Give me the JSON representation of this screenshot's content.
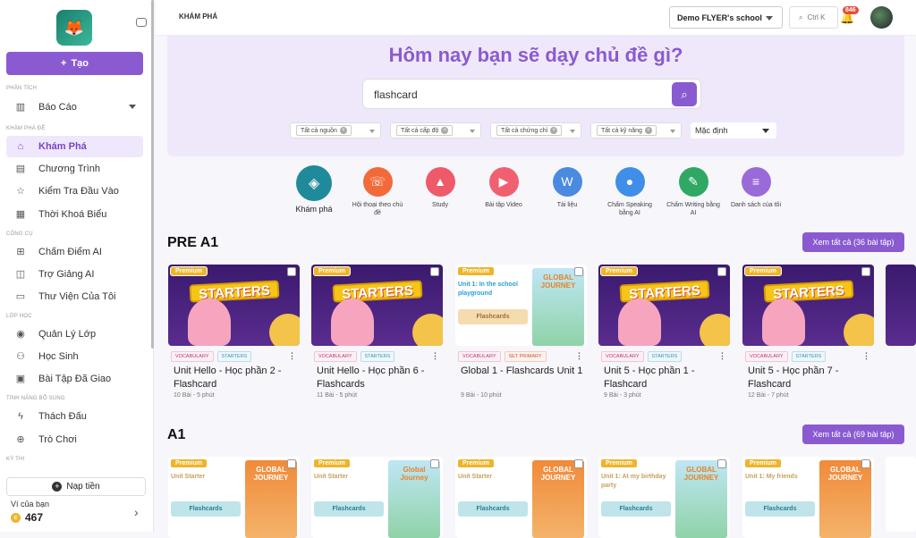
{
  "sidebar": {
    "create_label": "Tạo",
    "sections": {
      "analysis": "PHÂN TÍCH",
      "explore": "KHÁM PHÁ ĐỀ",
      "tools": "CÔNG CỤ",
      "classes": "LỚP HỌC",
      "extras": "TÍNH NĂNG BỔ SUNG",
      "exams": "KỲ THI"
    },
    "items": [
      {
        "label": "Báo Cáo",
        "icon": "report-icon"
      },
      {
        "label": "Khám Phá",
        "icon": "home-icon"
      },
      {
        "label": "Chương Trình",
        "icon": "document-icon"
      },
      {
        "label": "Kiểm Tra Đầu Vào",
        "icon": "star-icon"
      },
      {
        "label": "Thời Khoá Biểu",
        "icon": "calendar-icon"
      },
      {
        "label": "Chấm Điểm AI",
        "icon": "ai-grade-icon"
      },
      {
        "label": "Trợ Giảng AI",
        "icon": "ai-assistant-icon"
      },
      {
        "label": "Thư Viện Của Tôi",
        "icon": "folder-icon"
      },
      {
        "label": "Quản Lý Lớp",
        "icon": "class-icon"
      },
      {
        "label": "Học Sinh",
        "icon": "student-icon"
      },
      {
        "label": "Bài Tập Đã Giao",
        "icon": "assignment-icon"
      },
      {
        "label": "Thách Đấu",
        "icon": "lightning-icon"
      },
      {
        "label": "Trò Chơi",
        "icon": "gamepad-icon"
      }
    ],
    "wallet": {
      "topup_label": "Nạp tiền",
      "label": "Ví của bạn",
      "value": "467"
    }
  },
  "topbar": {
    "breadcrumb": "KHÁM PHÁ",
    "school": "Demo FLYER's school",
    "search_shortcut": "Ctrl K",
    "notif_count": "846"
  },
  "hero": {
    "title": "Hôm nay bạn sẽ dạy chủ đề gì?",
    "search_value": "flashcard",
    "filters": [
      "Tất cả nguồn",
      "Tất cả cấp độ",
      "Tất cả chứng chỉ",
      "Tất cả kỹ năng"
    ],
    "sort": "Mặc định"
  },
  "quick_actions": [
    {
      "label": "Khám phá",
      "color": "#1f8a9a",
      "icon": "compass-icon"
    },
    {
      "label": "Hội thoại theo chủ đề",
      "color": "#f26a3a",
      "icon": "phone-icon"
    },
    {
      "label": "Study",
      "color": "#ee5a6a",
      "icon": "graduation-icon"
    },
    {
      "label": "Bài tập Video",
      "color": "#f06070",
      "icon": "video-icon"
    },
    {
      "label": "Tài liệu",
      "color": "#4a8ae0",
      "icon": "word-icon"
    },
    {
      "label": "Chấm Speaking bằng AI",
      "color": "#3f8ee8",
      "icon": "microphone-icon"
    },
    {
      "label": "Chấm Writing bằng AI",
      "color": "#2fa866",
      "icon": "pen-icon"
    },
    {
      "label": "Danh sách của tôi",
      "color": "#9a6ad8",
      "icon": "list-icon"
    }
  ],
  "sections": [
    {
      "title": "PRE A1",
      "see_all": "Xem tất cả (36 bài tập)",
      "cards": [
        {
          "type": "starters",
          "premium": "Premium",
          "banner": "STARTERS",
          "tags": [
            "VOCABULARY",
            "STARTERS"
          ],
          "title": "Unit Hello - Học phần 2 - Flashcard",
          "meta": "10 Bài - 5 phút"
        },
        {
          "type": "starters",
          "premium": "Premium",
          "banner": "STARTERS",
          "tags": [
            "VOCABULARY",
            "STARTERS"
          ],
          "title": "Unit Hello - Học phần 6 - Flashcards",
          "meta": "11 Bài - 5 phút"
        },
        {
          "type": "global",
          "premium": "Premium",
          "lesson": "Unit 1: In the school playground",
          "flash": "Flashcards",
          "book": "GLOBAL JOURNEY",
          "tags": [
            "VOCABULARY",
            "SET PRIMARY"
          ],
          "title": "Global 1 - Flashcards Unit 1",
          "meta": "9 Bài - 10 phút"
        },
        {
          "type": "starters",
          "premium": "Premium",
          "banner": "STARTERS",
          "tags": [
            "VOCABULARY",
            "STARTERS"
          ],
          "title": "Unit 5 - Học phần 1 - Flashcard",
          "meta": "9 Bài - 3 phút"
        },
        {
          "type": "starters",
          "premium": "Premium",
          "banner": "STARTERS",
          "tags": [
            "VOCABULARY",
            "STARTERS"
          ],
          "title": "Unit 5 - Học phần 7 - Flashcard",
          "meta": "12 Bài - 7 phút"
        }
      ]
    },
    {
      "title": "A1",
      "see_all": "Xem tất cả (69 bài tập)",
      "cards": [
        {
          "premium": "Premium",
          "lesson": "Unit Starter",
          "flash": "Flashcards",
          "book": "GLOBAL JOURNEY"
        },
        {
          "premium": "Premium",
          "lesson": "Unit Starter",
          "flash": "Flashcards",
          "book": "Global Journey"
        },
        {
          "premium": "Premium",
          "lesson": "Unit Starter",
          "flash": "Flashcards",
          "book": "GLOBAL JOURNEY"
        },
        {
          "premium": "Premium",
          "lesson": "Unit 1: At my birthday party",
          "flash": "Flashcards",
          "book": "GLOBAL JOURNEY"
        },
        {
          "premium": "Premium",
          "lesson": "Unit 1: My friends",
          "flash": "Flashcards",
          "book": "GLOBAL JOURNEY"
        }
      ]
    }
  ]
}
